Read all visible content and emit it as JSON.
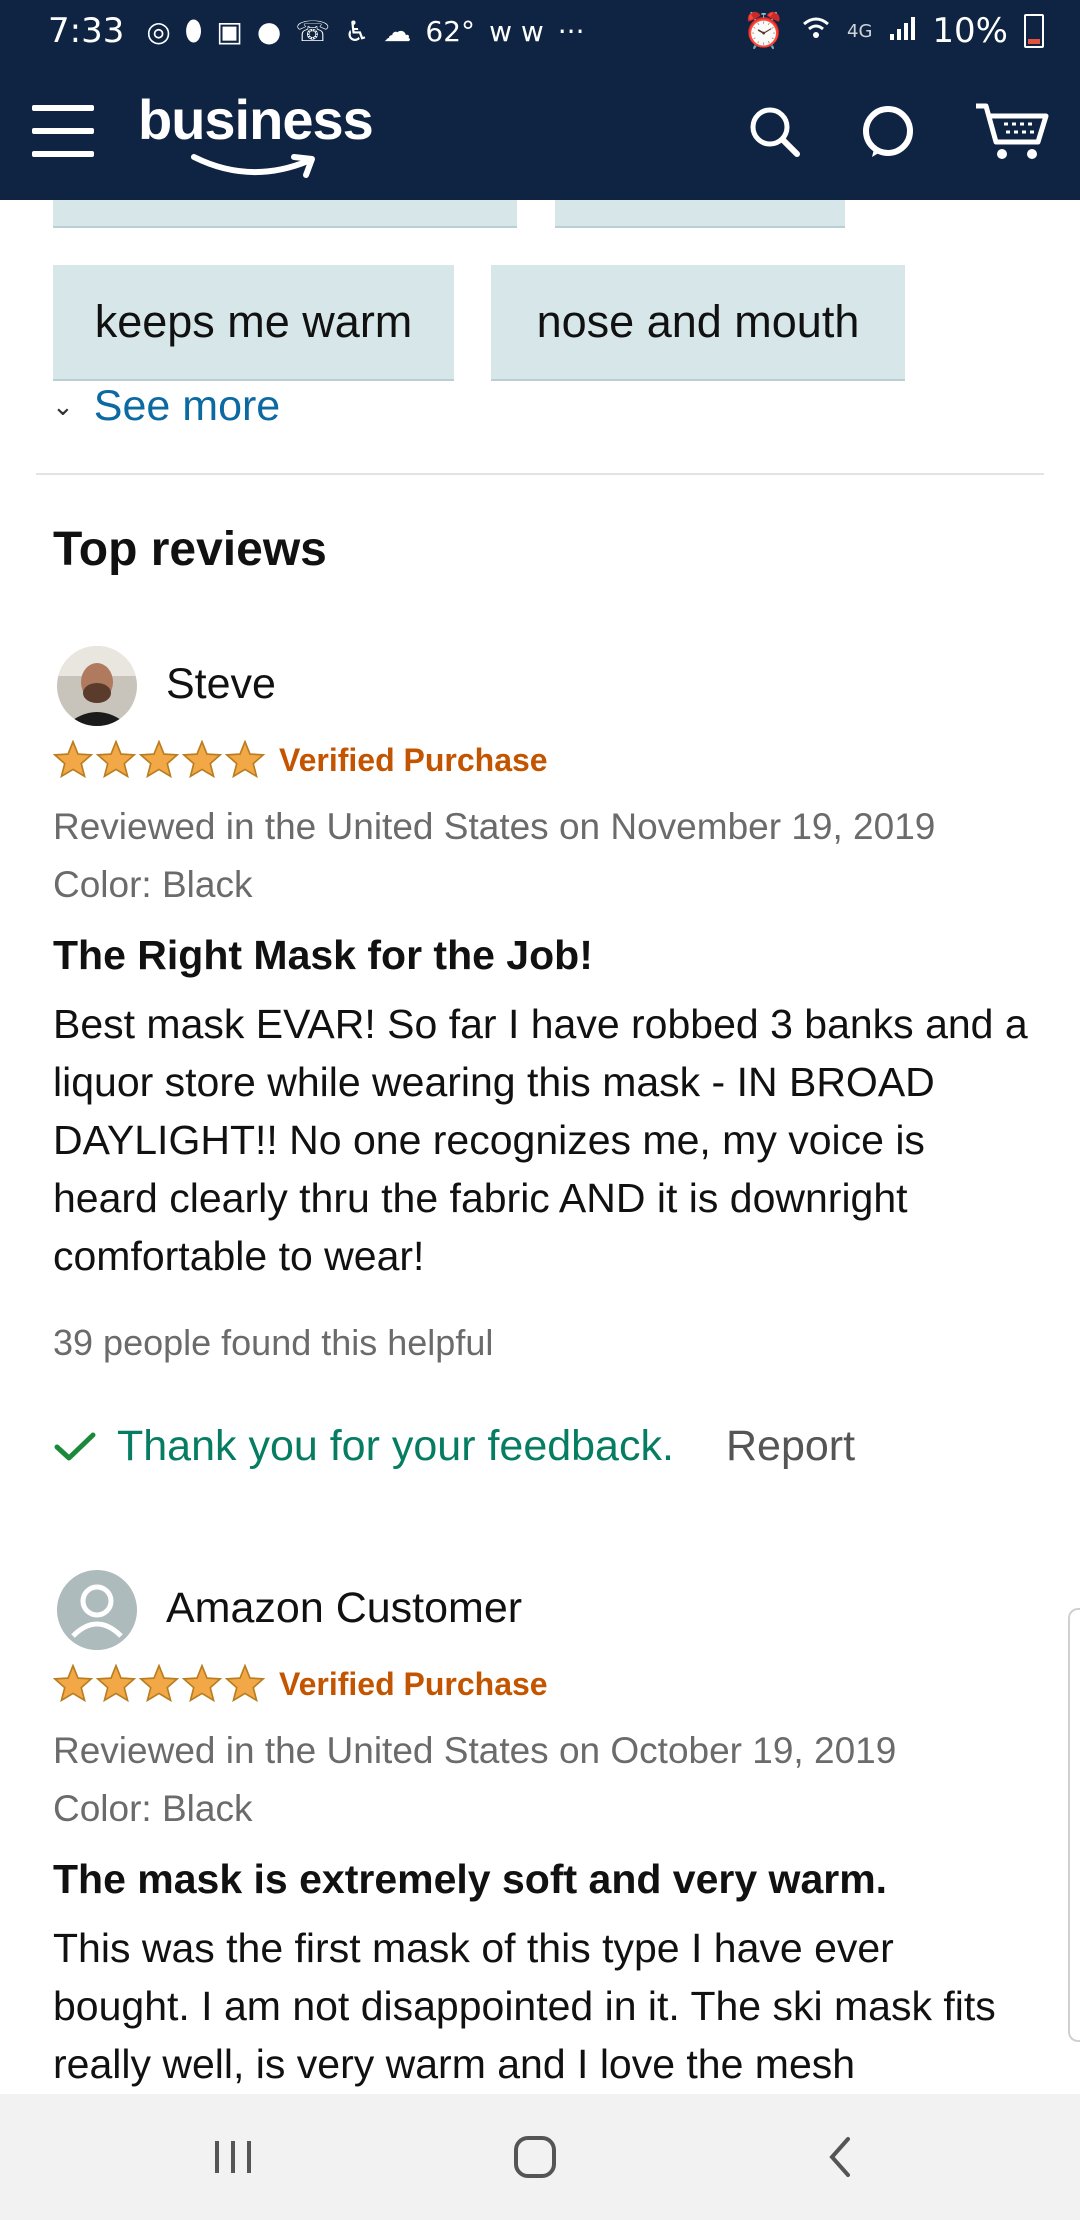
{
  "status_bar": {
    "time": "7:33",
    "temperature": "62°",
    "battery_percent": "10%",
    "network": "4G",
    "more_indicator": "···"
  },
  "header": {
    "logo_text": "business",
    "icons": [
      "menu-icon",
      "search-icon",
      "alexa-icon",
      "cart-icon"
    ]
  },
  "tags": {
    "row1": [
      "keeps me warm",
      "nose and mouth"
    ],
    "see_more": "See more"
  },
  "reviews_section": {
    "title": "Top reviews"
  },
  "reviews": [
    {
      "name": "Steve",
      "rating": 5,
      "verified": "Verified Purchase",
      "reviewed_line": "Reviewed in the United States on November 19, 2019",
      "color_line": "Color: Black",
      "title": "The Right Mask for the Job!",
      "body": "Best mask EVAR! So far I have robbed 3 banks and a liquor store while wearing this mask - IN BROAD DAYLIGHT!! No one recognizes me, my voice is heard clearly thru the fabric AND it is downright comfortable to wear!",
      "helpful": "39 people found this helpful",
      "feedback": "Thank you for your feedback.",
      "report": "Report"
    },
    {
      "name": "Amazon Customer",
      "rating": 5,
      "verified": "Verified Purchase",
      "reviewed_line": "Reviewed in the United States on October 19, 2019",
      "color_line": "Color: Black",
      "title": "The mask is extremely soft and very warm.",
      "body": "This was the first mask of this type I have ever bought. I am not disappointed in it. The ski mask fits really well, is very warm and I love the mesh"
    }
  ],
  "colors": {
    "header_bg": "#0f2442",
    "tag_bg": "#d6e6e9",
    "link": "#0b6aa2",
    "verified": "#c45500",
    "star": "#f3a847",
    "feedback_green": "#067d62"
  }
}
